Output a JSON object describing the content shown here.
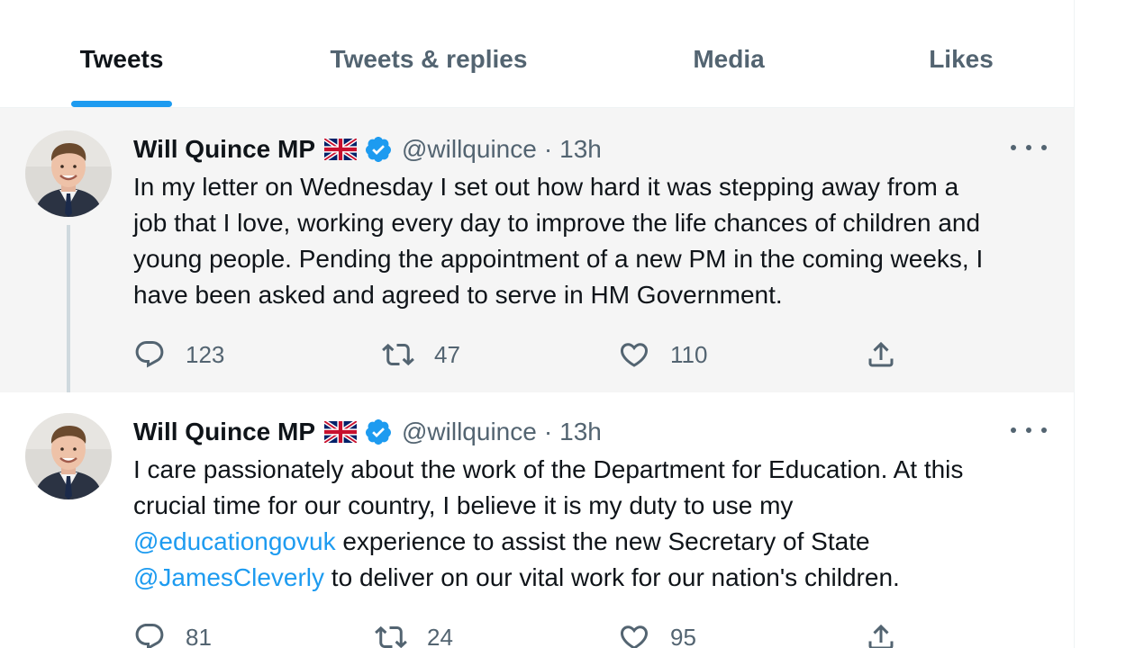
{
  "tabs": [
    {
      "label": "Tweets",
      "active": true
    },
    {
      "label": "Tweets & replies",
      "active": false
    },
    {
      "label": "Media",
      "active": false
    },
    {
      "label": "Likes",
      "active": false
    }
  ],
  "colors": {
    "accent": "#1d9bf0",
    "text": "#0f1419",
    "muted": "#536471"
  },
  "tweets": [
    {
      "author": {
        "name": "Will Quince MP",
        "flag": "uk-flag",
        "verified": true,
        "handle": "@willquince"
      },
      "separator": "·",
      "time": "13h",
      "text_lines": [
        "In my letter on Wednesday I set out how hard it was stepping away from a",
        "job that I love, working every day to improve the life chances of children and",
        "young people. Pending the appointment of a new PM in the coming weeks, I",
        "have been asked and agreed to serve in HM Government."
      ],
      "replies": "123",
      "retweets": "47",
      "likes": "110"
    },
    {
      "author": {
        "name": "Will Quince MP",
        "flag": "uk-flag",
        "verified": true,
        "handle": "@willquince"
      },
      "separator": "·",
      "time": "13h",
      "line1": "I care passionately about the work of the Department for Education. At this",
      "line2": "crucial time for our country, I believe it is my duty to use my",
      "mention1": "@educationgovuk",
      "line3_rest": " experience to assist the new Secretary of State",
      "mention2": "@JamesCleverly",
      "line4_rest": " to deliver on our vital work for our nation's children.",
      "replies": "81",
      "retweets": "24",
      "likes": "95"
    }
  ],
  "icons": {
    "reply": "reply-icon",
    "retweet": "retweet-icon",
    "like": "heart-icon",
    "share": "share-icon",
    "more": "more-icon",
    "verified": "verified-badge-icon"
  }
}
